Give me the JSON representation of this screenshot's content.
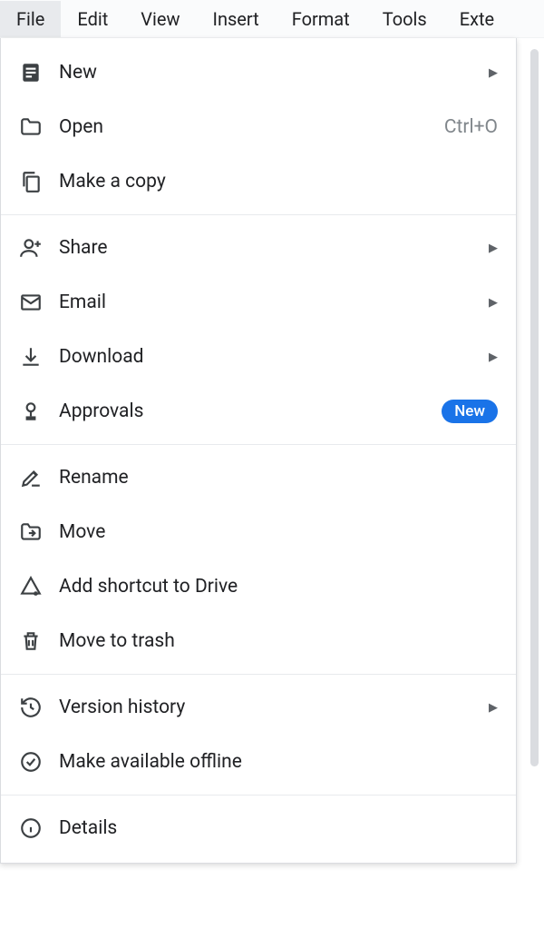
{
  "menubar": {
    "items": [
      {
        "label": "File",
        "active": true
      },
      {
        "label": "Edit",
        "active": false
      },
      {
        "label": "View",
        "active": false
      },
      {
        "label": "Insert",
        "active": false
      },
      {
        "label": "Format",
        "active": false
      },
      {
        "label": "Tools",
        "active": false
      },
      {
        "label": "Exte",
        "active": false
      }
    ]
  },
  "dropdown": {
    "groups": [
      [
        {
          "icon": "doc",
          "label": "New",
          "submenu": true
        },
        {
          "icon": "folder",
          "label": "Open",
          "shortcut": "Ctrl+O"
        },
        {
          "icon": "copy",
          "label": "Make a copy"
        }
      ],
      [
        {
          "icon": "person-add",
          "label": "Share",
          "submenu": true
        },
        {
          "icon": "email",
          "label": "Email",
          "submenu": true
        },
        {
          "icon": "download",
          "label": "Download",
          "submenu": true
        },
        {
          "icon": "approvals",
          "label": "Approvals",
          "badge": "New"
        }
      ],
      [
        {
          "icon": "rename",
          "label": "Rename"
        },
        {
          "icon": "move",
          "label": "Move"
        },
        {
          "icon": "shortcut",
          "label": "Add shortcut to Drive"
        },
        {
          "icon": "trash",
          "label": "Move to trash"
        }
      ],
      [
        {
          "icon": "history",
          "label": "Version history",
          "submenu": true
        },
        {
          "icon": "offline",
          "label": "Make available offline"
        }
      ],
      [
        {
          "icon": "info",
          "label": "Details"
        }
      ]
    ]
  }
}
